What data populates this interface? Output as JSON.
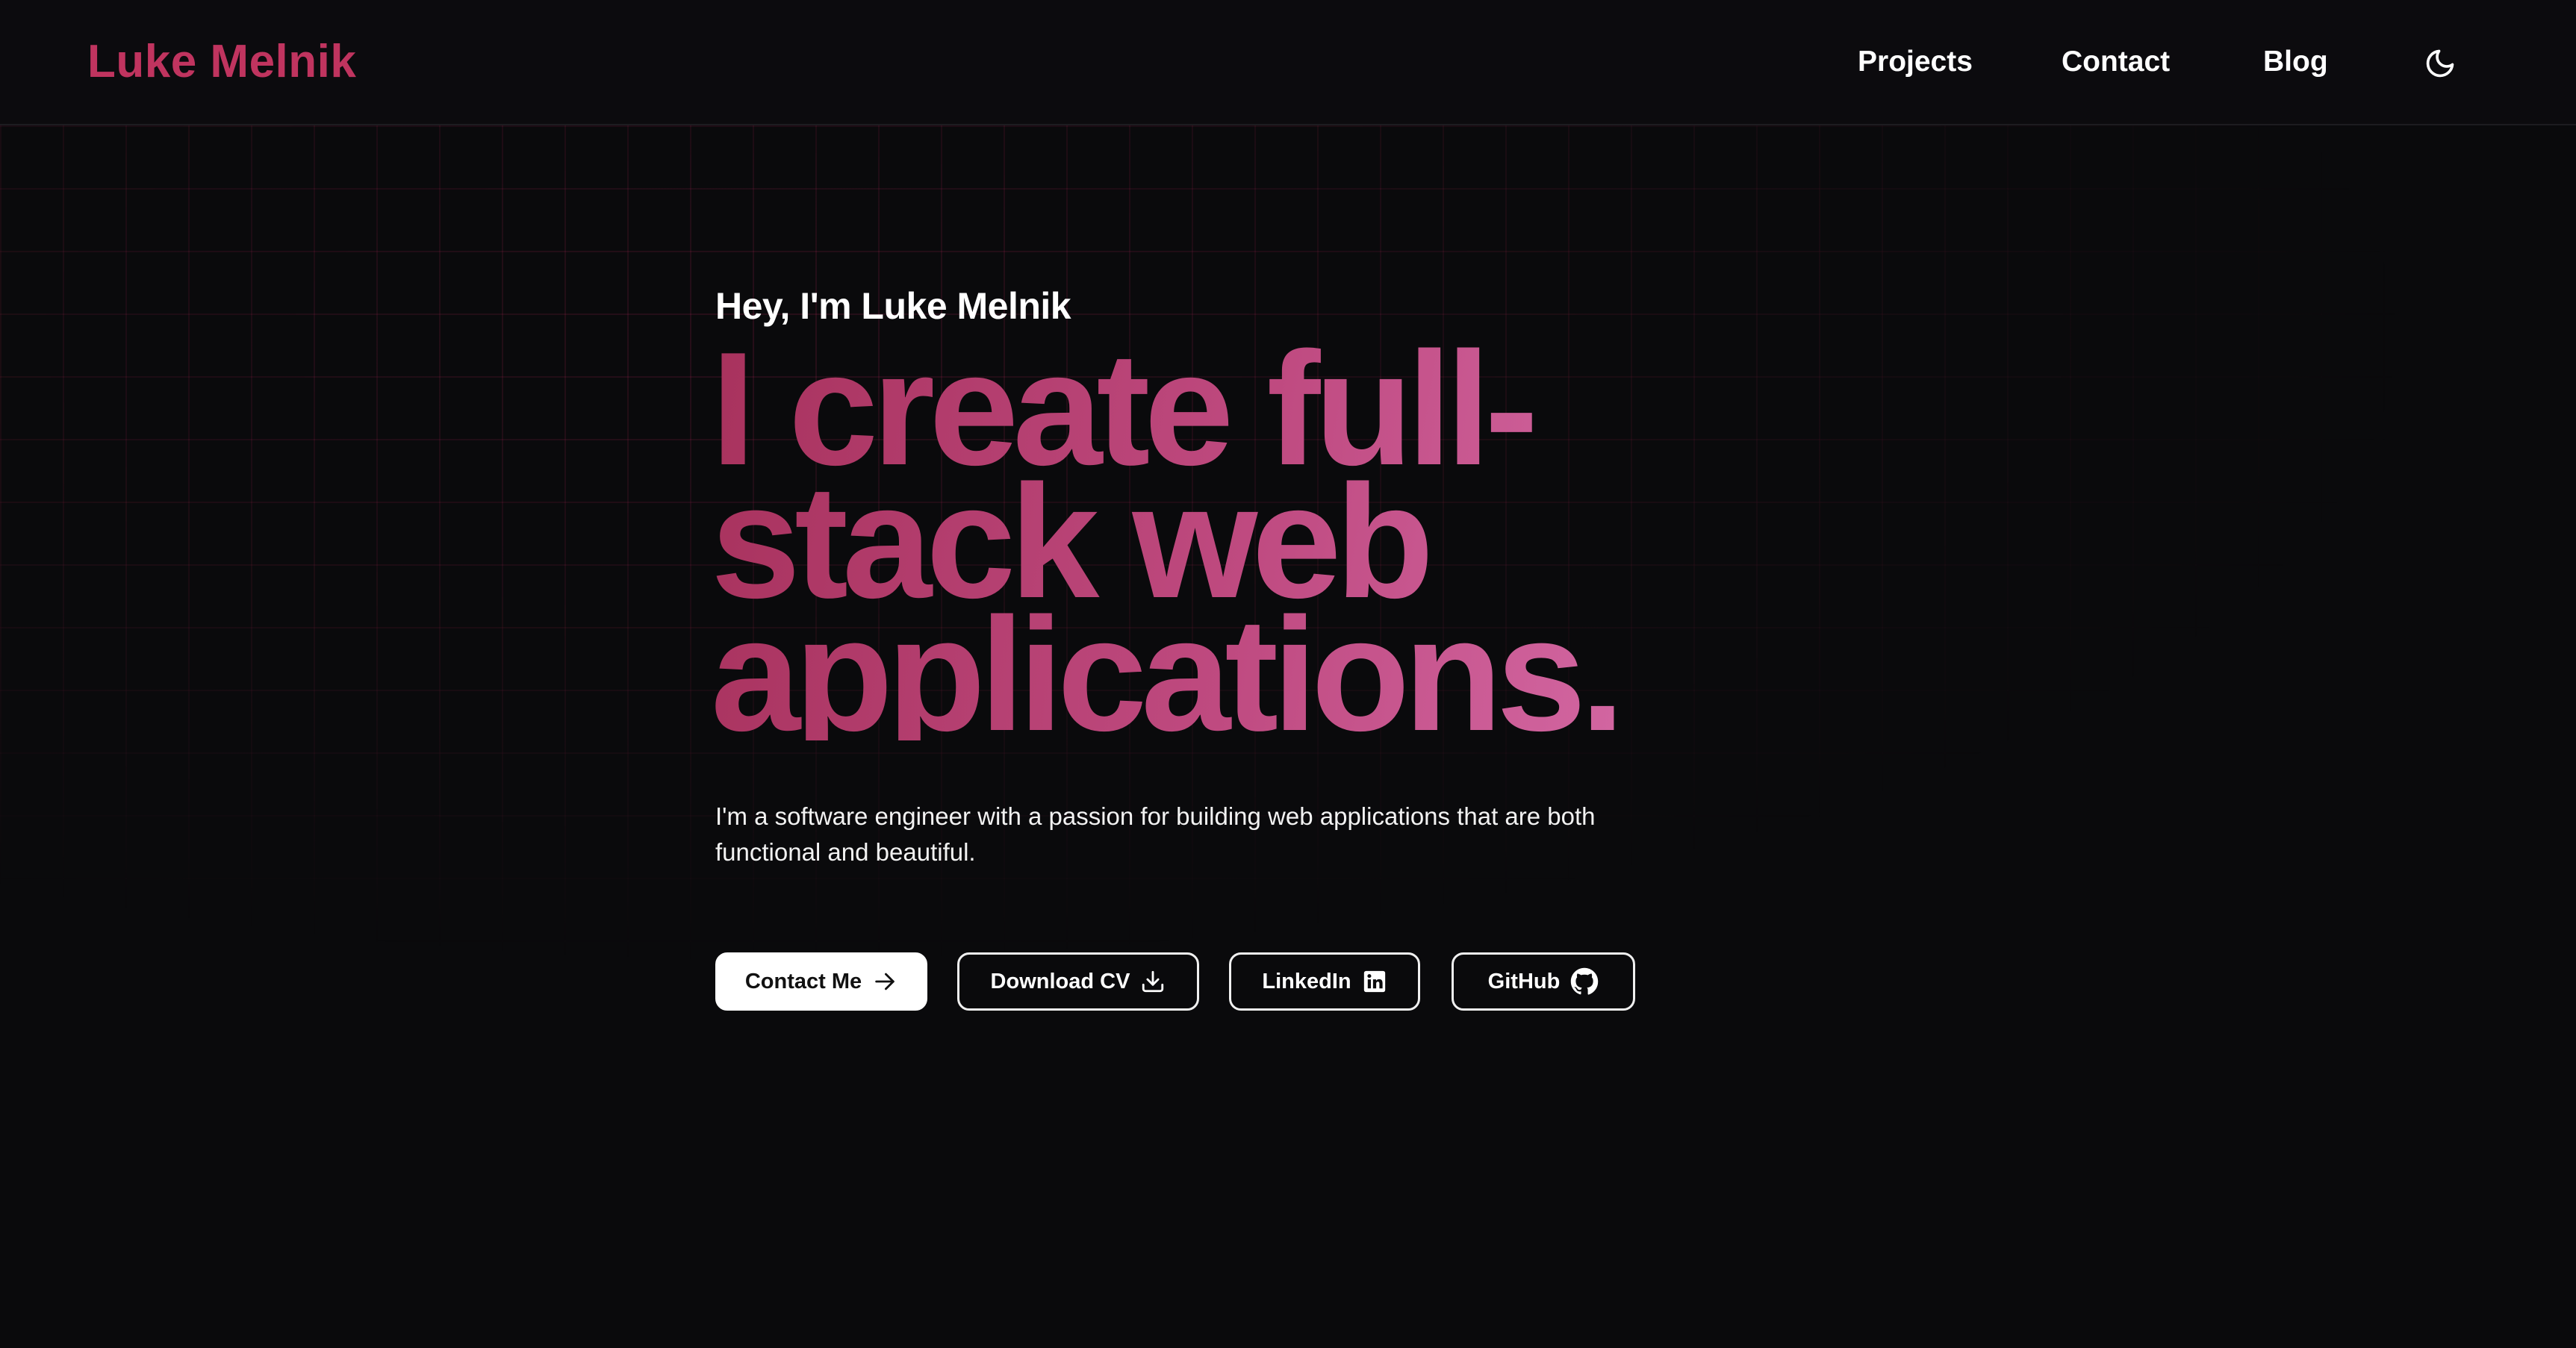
{
  "header": {
    "brand": "Luke Melnik",
    "nav": [
      {
        "label": "Projects"
      },
      {
        "label": "Contact"
      },
      {
        "label": "Blog"
      }
    ],
    "theme_toggle_icon": "moon-icon"
  },
  "hero": {
    "greeting": "Hey, I'm Luke Melnik",
    "headline_lines": [
      "I create full-",
      "stack web",
      "applications."
    ],
    "description": "I'm a software engineer with a passion for building web applications that are both functional and beautiful.",
    "buttons": [
      {
        "label": "Contact Me",
        "icon": "arrow-right-icon",
        "style": "primary"
      },
      {
        "label": "Download CV",
        "icon": "download-icon",
        "style": "outline"
      },
      {
        "label": "LinkedIn",
        "icon": "linkedin-icon",
        "style": "outline"
      },
      {
        "label": "GitHub",
        "icon": "github-icon",
        "style": "outline"
      }
    ]
  },
  "colors": {
    "background": "#0a0a0c",
    "brand": "#c0345f",
    "headline_gradient_start": "#a8325d",
    "headline_gradient_end": "#d56aa6",
    "grid_line": "#be285a"
  }
}
